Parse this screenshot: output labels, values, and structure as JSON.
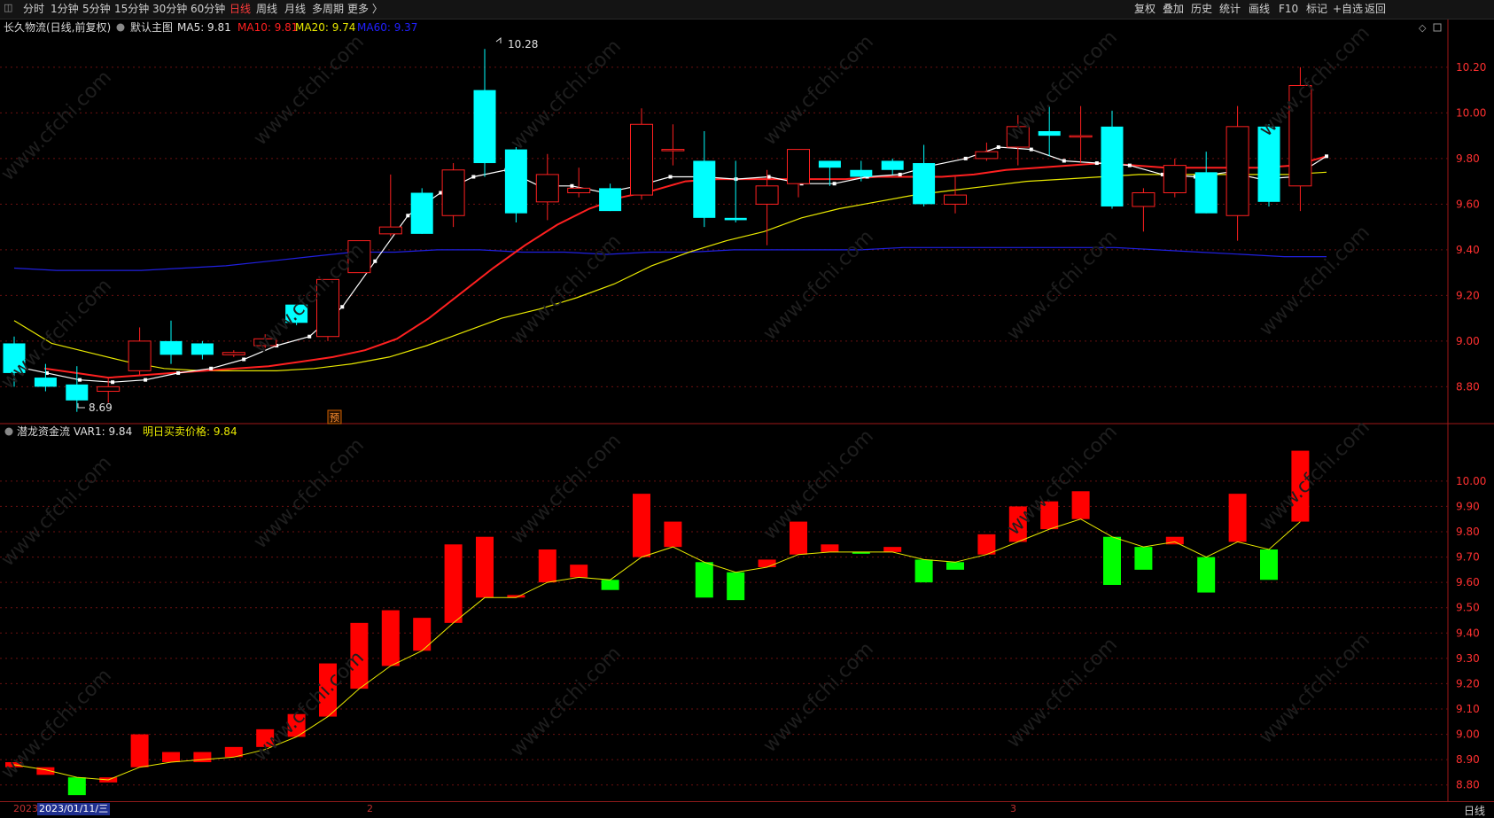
{
  "toolbar": {
    "periods": [
      "分时",
      "1分钟",
      "5分钟",
      "15分钟",
      "30分钟",
      "60分钟",
      "日线",
      "周线",
      "月线",
      "多周期",
      "更多 〉"
    ],
    "active_period": "日线",
    "right_buttons": [
      "复权",
      "叠加",
      "历史",
      "统计",
      "画线",
      "F10",
      "标记",
      "+自选",
      "返回"
    ]
  },
  "main_panel": {
    "stock_label": "长久物流(日线,前复权)",
    "chart_name": "默认主图",
    "ma_items": [
      {
        "label": "MA5: 9.81",
        "color": "#e0e0e0"
      },
      {
        "label": "MA10: 9.81",
        "color": "#ff2020"
      },
      {
        "label": "MA20: 9.74",
        "color": "#e8e800"
      },
      {
        "label": "MA60: 9.37",
        "color": "#2020ff"
      }
    ],
    "high_label": "10.28",
    "low_label": "8.69",
    "forecast_badge": "预",
    "y_ticks": [
      "10.20",
      "10.00",
      "9.80",
      "9.60",
      "9.40",
      "9.20",
      "9.00",
      "8.80"
    ]
  },
  "sub_panel": {
    "name": "潜龙资金流",
    "var_label": "VAR1: 9.84",
    "price_label": "明日买卖价格: 9.84",
    "y_ticks": [
      "10.00",
      "9.90",
      "9.80",
      "9.70",
      "9.60",
      "9.50",
      "9.40",
      "9.30",
      "9.20",
      "9.10",
      "9.00",
      "8.90",
      "8.80"
    ]
  },
  "bottom": {
    "year": "2023",
    "cursor_date": "2023/01/11/三",
    "month_marks": [
      "2",
      "3"
    ],
    "period_tag": "日线"
  },
  "colors": {
    "up": "#ff2020",
    "down": "#00ffff",
    "sub_up": "#ff0000",
    "sub_down": "#00ff00",
    "ma5": "#ffffff",
    "ma10": "#ff2020",
    "ma20": "#e8e800",
    "ma60": "#2020e0",
    "grid": "#6b1010",
    "axis": "#ff3030"
  },
  "chart_data": {
    "type": "candlestick",
    "main_ylim": [
      8.65,
      10.32
    ],
    "sub_ylim": [
      8.75,
      10.15
    ],
    "candles": [
      {
        "o": 8.99,
        "c": 8.86,
        "h": 9.02,
        "l": 8.8
      },
      {
        "o": 8.84,
        "c": 8.8,
        "h": 8.9,
        "l": 8.78
      },
      {
        "o": 8.81,
        "c": 8.74,
        "h": 8.89,
        "l": 8.69
      },
      {
        "o": 8.78,
        "c": 8.8,
        "h": 8.84,
        "l": 8.73
      },
      {
        "o": 8.87,
        "c": 9.0,
        "h": 9.06,
        "l": 8.85
      },
      {
        "o": 9.0,
        "c": 8.94,
        "h": 9.09,
        "l": 8.9
      },
      {
        "o": 8.99,
        "c": 8.94,
        "h": 9.0,
        "l": 8.92
      },
      {
        "o": 8.94,
        "c": 8.95,
        "h": 8.96,
        "l": 8.93
      },
      {
        "o": 8.98,
        "c": 9.01,
        "h": 9.03,
        "l": 8.97
      },
      {
        "o": 9.16,
        "c": 9.08,
        "h": 9.16,
        "l": 9.07
      },
      {
        "o": 9.02,
        "c": 9.27,
        "h": 9.27,
        "l": 9.0
      },
      {
        "o": 9.3,
        "c": 9.44,
        "h": 9.44,
        "l": 9.3
      },
      {
        "o": 9.47,
        "c": 9.5,
        "h": 9.73,
        "l": 9.46
      },
      {
        "o": 9.65,
        "c": 9.47,
        "h": 9.67,
        "l": 9.47
      },
      {
        "o": 9.55,
        "c": 9.75,
        "h": 9.78,
        "l": 9.5
      },
      {
        "o": 10.1,
        "c": 9.78,
        "h": 10.28,
        "l": 9.72
      },
      {
        "o": 9.84,
        "c": 9.56,
        "h": 9.85,
        "l": 9.52
      },
      {
        "o": 9.61,
        "c": 9.73,
        "h": 9.82,
        "l": 9.53
      },
      {
        "o": 9.65,
        "c": 9.67,
        "h": 9.76,
        "l": 9.63
      },
      {
        "o": 9.67,
        "c": 9.57,
        "h": 9.69,
        "l": 9.57
      },
      {
        "o": 9.64,
        "c": 9.95,
        "h": 10.02,
        "l": 9.62
      },
      {
        "o": 9.84,
        "c": 9.84,
        "h": 9.95,
        "l": 9.77
      },
      {
        "o": 9.79,
        "c": 9.54,
        "h": 9.92,
        "l": 9.5
      },
      {
        "o": 9.54,
        "c": 9.53,
        "h": 9.79,
        "l": 9.52
      },
      {
        "o": 9.6,
        "c": 9.68,
        "h": 9.75,
        "l": 9.42
      },
      {
        "o": 9.69,
        "c": 9.84,
        "h": 9.84,
        "l": 9.63
      },
      {
        "o": 9.79,
        "c": 9.76,
        "h": 9.79,
        "l": 9.68
      },
      {
        "o": 9.75,
        "c": 9.72,
        "h": 9.79,
        "l": 9.7
      },
      {
        "o": 9.79,
        "c": 9.75,
        "h": 9.8,
        "l": 9.73
      },
      {
        "o": 9.78,
        "c": 9.6,
        "h": 9.86,
        "l": 9.59
      },
      {
        "o": 9.6,
        "c": 9.64,
        "h": 9.72,
        "l": 9.56
      },
      {
        "o": 9.8,
        "c": 9.83,
        "h": 9.87,
        "l": 9.79
      },
      {
        "o": 9.85,
        "c": 9.94,
        "h": 9.99,
        "l": 9.77
      },
      {
        "o": 9.92,
        "c": 9.9,
        "h": 10.03,
        "l": 9.81
      },
      {
        "o": 9.9,
        "c": 9.9,
        "h": 10.03,
        "l": 9.78
      },
      {
        "o": 9.94,
        "c": 9.59,
        "h": 10.01,
        "l": 9.58
      },
      {
        "o": 9.59,
        "c": 9.65,
        "h": 9.67,
        "l": 9.48
      },
      {
        "o": 9.65,
        "c": 9.77,
        "h": 9.8,
        "l": 9.63
      },
      {
        "o": 9.74,
        "c": 9.56,
        "h": 9.83,
        "l": 9.56
      },
      {
        "o": 9.55,
        "c": 9.94,
        "h": 10.03,
        "l": 9.44
      },
      {
        "o": 9.94,
        "c": 9.61,
        "h": 9.95,
        "l": 9.59
      },
      {
        "o": 9.68,
        "c": 10.12,
        "h": 10.2,
        "l": 9.57
      }
    ],
    "ma5": [
      8.89,
      8.86,
      8.83,
      8.82,
      8.83,
      8.86,
      8.88,
      8.92,
      8.98,
      9.02,
      9.15,
      9.35,
      9.55,
      9.65,
      9.72,
      9.75,
      9.68,
      9.68,
      9.65,
      9.68,
      9.72,
      9.72,
      9.71,
      9.72,
      9.69,
      9.69,
      9.72,
      9.73,
      9.77,
      9.8,
      9.85,
      9.84,
      9.79,
      9.78,
      9.77,
      9.73,
      9.72,
      9.74,
      9.71,
      9.72,
      9.81
    ],
    "ma10": [
      8.88,
      8.86,
      8.84,
      8.85,
      8.86,
      8.87,
      8.88,
      8.89,
      8.91,
      8.93,
      8.96,
      9.01,
      9.1,
      9.21,
      9.32,
      9.42,
      9.51,
      9.58,
      9.63,
      9.66,
      9.7,
      9.71,
      9.71,
      9.71,
      9.71,
      9.71,
      9.72,
      9.72,
      9.72,
      9.73,
      9.75,
      9.76,
      9.77,
      9.78,
      9.77,
      9.76,
      9.76,
      9.76,
      9.76,
      9.77,
      9.81
    ],
    "ma20": [
      9.09,
      8.99,
      8.95,
      8.91,
      8.88,
      8.87,
      8.87,
      8.87,
      8.88,
      8.9,
      8.93,
      8.98,
      9.04,
      9.1,
      9.14,
      9.19,
      9.25,
      9.33,
      9.39,
      9.44,
      9.48,
      9.54,
      9.58,
      9.61,
      9.64,
      9.66,
      9.68,
      9.7,
      9.71,
      9.72,
      9.73,
      9.73,
      9.73,
      9.73,
      9.73,
      9.74
    ],
    "ma60": [
      9.32,
      9.31,
      9.31,
      9.31,
      9.32,
      9.33,
      9.35,
      9.37,
      9.39,
      9.39,
      9.4,
      9.4,
      9.39,
      9.39,
      9.38,
      9.39,
      9.39,
      9.4,
      9.4,
      9.4,
      9.4,
      9.41,
      9.41,
      9.41,
      9.41,
      9.41,
      9.41,
      9.4,
      9.39,
      9.38,
      9.37,
      9.37
    ],
    "sub_bars": [
      {
        "a": 8.87,
        "b": 8.89
      },
      {
        "a": 8.84,
        "b": 8.87
      },
      {
        "a": 8.76,
        "b": 8.83
      },
      {
        "a": 8.81,
        "b": 8.83
      },
      {
        "a": 8.87,
        "b": 9.0
      },
      {
        "a": 8.89,
        "b": 8.93
      },
      {
        "a": 8.89,
        "b": 8.93
      },
      {
        "a": 8.91,
        "b": 8.95
      },
      {
        "a": 8.95,
        "b": 9.02
      },
      {
        "a": 8.99,
        "b": 9.08
      },
      {
        "a": 9.07,
        "b": 9.28
      },
      {
        "a": 9.18,
        "b": 9.44
      },
      {
        "a": 9.27,
        "b": 9.49
      },
      {
        "a": 9.33,
        "b": 9.46
      },
      {
        "a": 9.44,
        "b": 9.75
      },
      {
        "a": 9.54,
        "b": 9.78
      },
      {
        "a": 9.54,
        "b": 9.55
      },
      {
        "a": 9.6,
        "b": 9.73
      },
      {
        "a": 9.62,
        "b": 9.67
      },
      {
        "a": 9.57,
        "b": 9.61
      },
      {
        "a": 9.7,
        "b": 9.95
      },
      {
        "a": 9.74,
        "b": 9.84
      },
      {
        "a": 9.54,
        "b": 9.68
      },
      {
        "a": 9.53,
        "b": 9.64
      },
      {
        "a": 9.66,
        "b": 9.69
      },
      {
        "a": 9.71,
        "b": 9.84
      },
      {
        "a": 9.72,
        "b": 9.75
      },
      {
        "a": 9.72,
        "b": 9.72
      },
      {
        "a": 9.72,
        "b": 9.74
      },
      {
        "a": 9.6,
        "b": 9.69
      },
      {
        "a": 9.65,
        "b": 9.68
      },
      {
        "a": 9.71,
        "b": 9.79
      },
      {
        "a": 9.76,
        "b": 9.9
      },
      {
        "a": 9.81,
        "b": 9.92
      },
      {
        "a": 9.85,
        "b": 9.96
      },
      {
        "a": 9.59,
        "b": 9.78
      },
      {
        "a": 9.65,
        "b": 9.74
      },
      {
        "a": 9.75,
        "b": 9.78
      },
      {
        "a": 9.56,
        "b": 9.7
      },
      {
        "a": 9.76,
        "b": 9.95
      },
      {
        "a": 9.61,
        "b": 9.73
      },
      {
        "a": 9.84,
        "b": 10.12
      }
    ],
    "sub_line": [
      8.88,
      8.86,
      8.83,
      8.82,
      8.87,
      8.89,
      8.9,
      8.91,
      8.94,
      8.99,
      9.07,
      9.18,
      9.27,
      9.33,
      9.44,
      9.54,
      9.54,
      9.6,
      9.62,
      9.61,
      9.7,
      9.74,
      9.68,
      9.64,
      9.66,
      9.71,
      9.72,
      9.72,
      9.72,
      9.69,
      9.68,
      9.71,
      9.76,
      9.81,
      9.85,
      9.78,
      9.74,
      9.76,
      9.7,
      9.76,
      9.73,
      9.84
    ]
  }
}
